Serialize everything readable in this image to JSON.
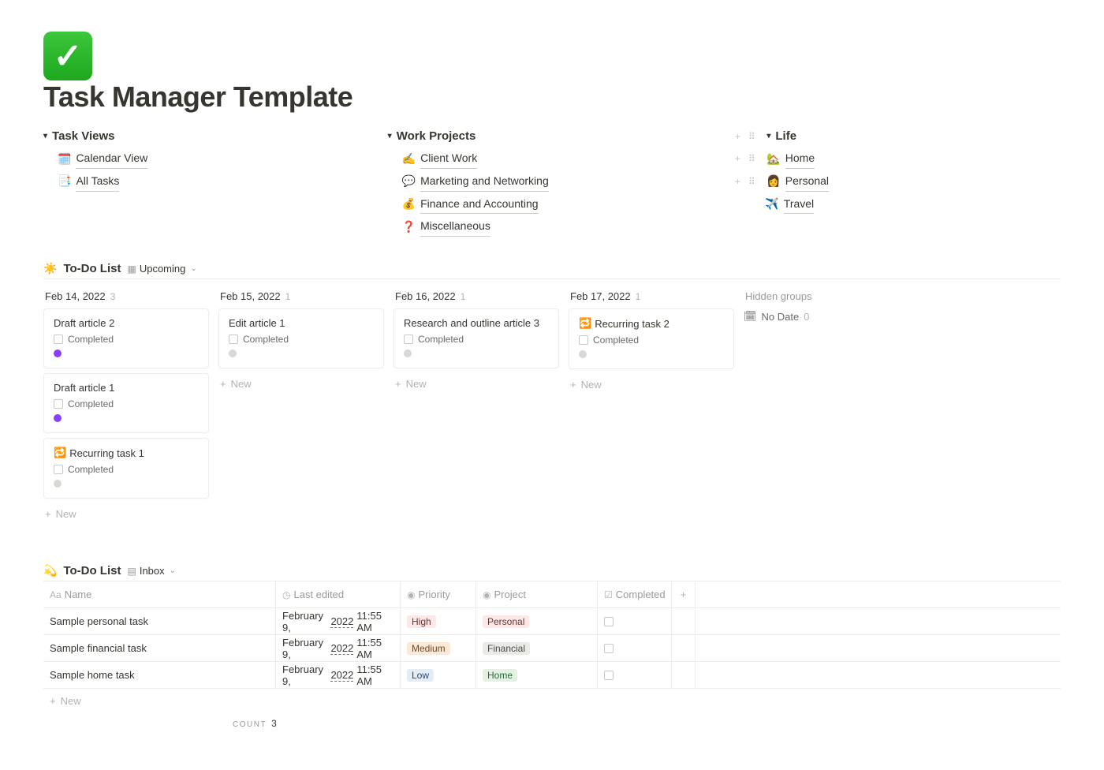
{
  "page": {
    "title": "Task Manager Template"
  },
  "nav": {
    "taskViews": {
      "header": "Task Views",
      "items": [
        {
          "emoji": "🗓️",
          "label": "Calendar View"
        },
        {
          "emoji": "📑",
          "label": "All Tasks"
        }
      ]
    },
    "workProjects": {
      "header": "Work Projects",
      "items": [
        {
          "emoji": "✍️",
          "label": "Client Work"
        },
        {
          "emoji": "💬",
          "label": "Marketing and Networking"
        },
        {
          "emoji": "💰",
          "label": "Finance and Accounting"
        },
        {
          "emoji": "❓",
          "label": "Miscellaneous"
        }
      ]
    },
    "life": {
      "header": "Life",
      "items": [
        {
          "emoji": "🏡",
          "label": "Home"
        },
        {
          "emoji": "👩",
          "label": "Personal"
        },
        {
          "emoji": "✈️",
          "label": "Travel"
        }
      ]
    }
  },
  "board": {
    "titleEmoji": "☀️",
    "title": "To-Do List",
    "viewName": "Upcoming",
    "hiddenGroupsLabel": "Hidden groups",
    "noDate": {
      "label": "No Date",
      "count": "0"
    },
    "columns": [
      {
        "date": "Feb 14, 2022",
        "count": "3",
        "cards": [
          {
            "title": "Draft article 2",
            "completedLabel": "Completed",
            "dot": "purple"
          },
          {
            "title": "Draft article 1",
            "completedLabel": "Completed",
            "dot": "purple"
          },
          {
            "emoji": "🔁",
            "title": "Recurring task 1",
            "completedLabel": "Completed",
            "dot": "grey"
          }
        ]
      },
      {
        "date": "Feb 15, 2022",
        "count": "1",
        "cards": [
          {
            "title": "Edit article 1",
            "completedLabel": "Completed",
            "dot": "grey"
          }
        ]
      },
      {
        "date": "Feb 16, 2022",
        "count": "1",
        "cards": [
          {
            "title": "Research and outline article 3",
            "completedLabel": "Completed",
            "dot": "grey"
          }
        ]
      },
      {
        "date": "Feb 17, 2022",
        "count": "1",
        "cards": [
          {
            "emoji": "🔁",
            "title": "Recurring task 2",
            "completedLabel": "Completed",
            "dot": "grey"
          }
        ]
      }
    ],
    "newLabel": "New"
  },
  "table": {
    "titleEmoji": "💫",
    "title": "To-Do List",
    "viewName": "Inbox",
    "headers": {
      "name": "Name",
      "lastEdited": "Last edited",
      "priority": "Priority",
      "project": "Project",
      "completed": "Completed"
    },
    "rows": [
      {
        "name": "Sample personal task",
        "lastEdited": "February 9, 2022 11:55 AM",
        "priority": "High",
        "priorityClass": "high",
        "project": "Personal",
        "projectClass": "personal"
      },
      {
        "name": "Sample financial task",
        "lastEdited": "February 9, 2022 11:55 AM",
        "priority": "Medium",
        "priorityClass": "medium",
        "project": "Financial",
        "projectClass": "financial"
      },
      {
        "name": "Sample home task",
        "lastEdited": "February 9, 2022 11:55 AM",
        "priority": "Low",
        "priorityClass": "low",
        "project": "Home",
        "projectClass": "home"
      }
    ],
    "newLabel": "New",
    "countLabel": "COUNT",
    "countValue": "3"
  }
}
